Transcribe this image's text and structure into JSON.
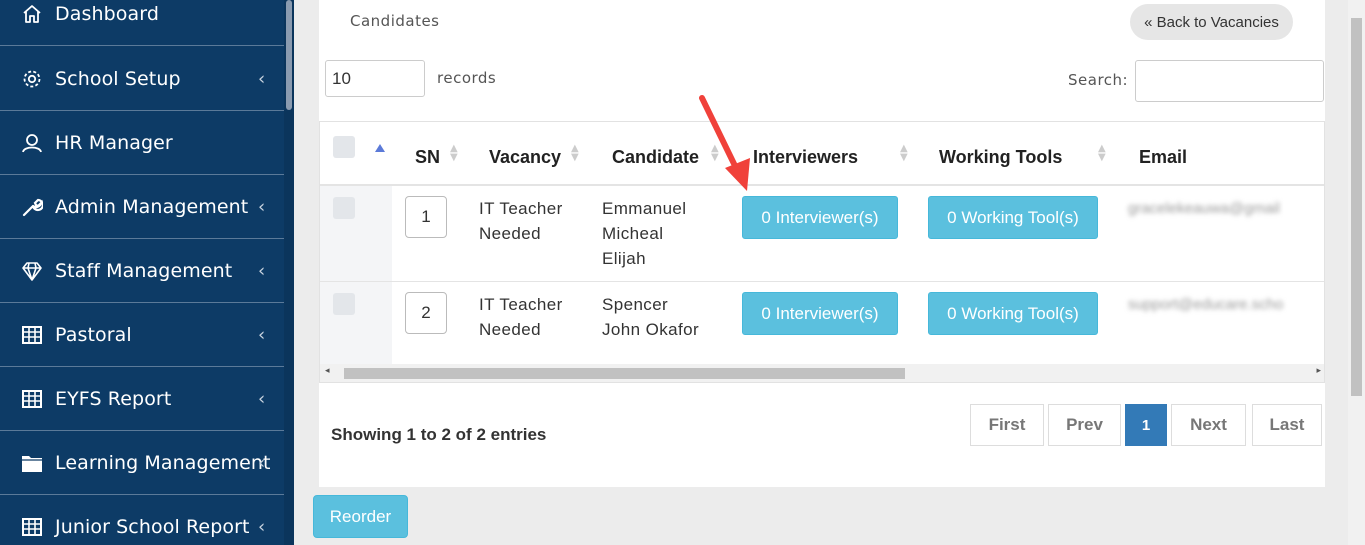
{
  "sidebar": {
    "items": [
      {
        "label": "Dashboard",
        "icon": "home-icon",
        "chevron": ""
      },
      {
        "label": "School Setup",
        "icon": "gear-icon",
        "chevron": "‹"
      },
      {
        "label": "HR Manager",
        "icon": "user-icon",
        "chevron": ""
      },
      {
        "label": "Admin Management",
        "icon": "wrench-icon",
        "chevron": "‹"
      },
      {
        "label": "Staff Management",
        "icon": "diamond-icon",
        "chevron": "‹"
      },
      {
        "label": "Pastoral",
        "icon": "table-icon",
        "chevron": "‹"
      },
      {
        "label": "EYFS Report",
        "icon": "table-icon",
        "chevron": "‹"
      },
      {
        "label": "Learning Management",
        "icon": "folder-icon",
        "chevron": "‹"
      },
      {
        "label": "Junior School Report",
        "icon": "table-icon",
        "chevron": "‹"
      }
    ]
  },
  "main": {
    "section_title": "Candidates",
    "back_button": "« Back to Vacancies",
    "records_value": "10",
    "records_label": "records",
    "search_label": "Search:",
    "columns": [
      "SN",
      "Vacancy",
      "Candidate",
      "Interviewers",
      "Working Tools",
      "Email"
    ],
    "rows": [
      {
        "sn": "1",
        "vacancy": [
          "IT Teacher",
          "Needed"
        ],
        "candidate": [
          "Emmanuel",
          "Micheal",
          "Elijah"
        ],
        "interviewers": "0 Interviewer(s)",
        "tools": "0 Working Tool(s)",
        "email": "gracelekeauwa@gmail"
      },
      {
        "sn": "2",
        "vacancy": [
          "IT Teacher",
          "Needed"
        ],
        "candidate": [
          "Spencer",
          "John Okafor"
        ],
        "interviewers": "0 Interviewer(s)",
        "tools": "0 Working Tool(s)",
        "email": "support@educare.scho"
      }
    ],
    "showing": "Showing 1 to 2 of 2 entries",
    "pagination": {
      "first": "First",
      "prev": "Prev",
      "current": "1",
      "next": "Next",
      "last": "Last"
    },
    "reorder_button": "Reorder"
  },
  "colors": {
    "sidebar": "#0d3b66",
    "info_button": "#5bc0de",
    "active_page": "#337ab7",
    "annotation": "#f0413a"
  }
}
